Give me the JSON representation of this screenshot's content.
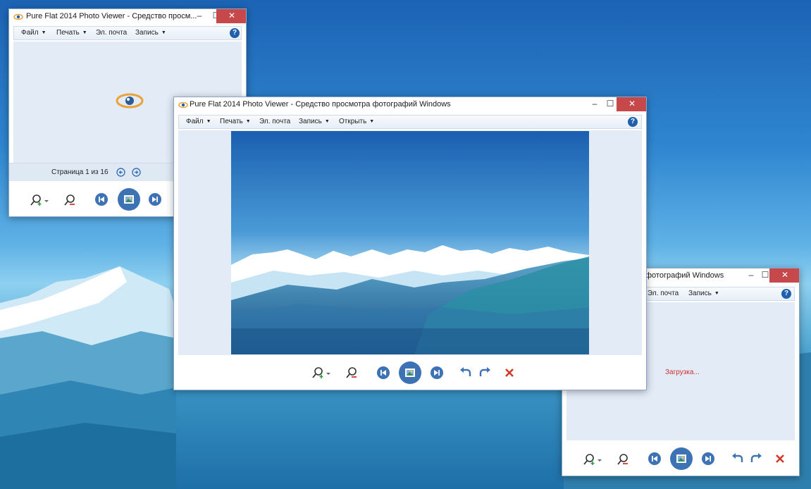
{
  "colors": {
    "accent": "#3d73b4",
    "close": "#c7484a",
    "delete": "#d23a2a",
    "loading": "#d03030",
    "eye": "#e8a33a"
  },
  "win1": {
    "title": "Pure Flat 2014 Photo Viewer - Средство просм...",
    "menu": [
      "Файл",
      "Печать",
      "Эл. почта",
      "Запись"
    ],
    "help": "?",
    "status": "Страница 1 из 16"
  },
  "win2": {
    "title": "Pure Flat 2014 Photo Viewer - Средство просмотра фотографий Windows",
    "menu": [
      "Файл",
      "Печать",
      "Эл. почта",
      "Запись",
      "Открыть"
    ],
    "help": "?"
  },
  "win3": {
    "title": "фотографий Windows",
    "menu": [
      "Эл. почта",
      "Запись"
    ],
    "help": "?",
    "loading": "Загрузка..."
  },
  "controls": {
    "minimize": "–",
    "maximize": "☐",
    "close": "✕"
  },
  "icons": [
    "eye-icon",
    "zoom-in-icon",
    "zoom-out-icon",
    "previous-icon",
    "slideshow-icon",
    "next-icon",
    "rotate-left-icon",
    "rotate-right-icon",
    "delete-icon",
    "help-icon",
    "page-prev-icon",
    "page-next-icon"
  ]
}
